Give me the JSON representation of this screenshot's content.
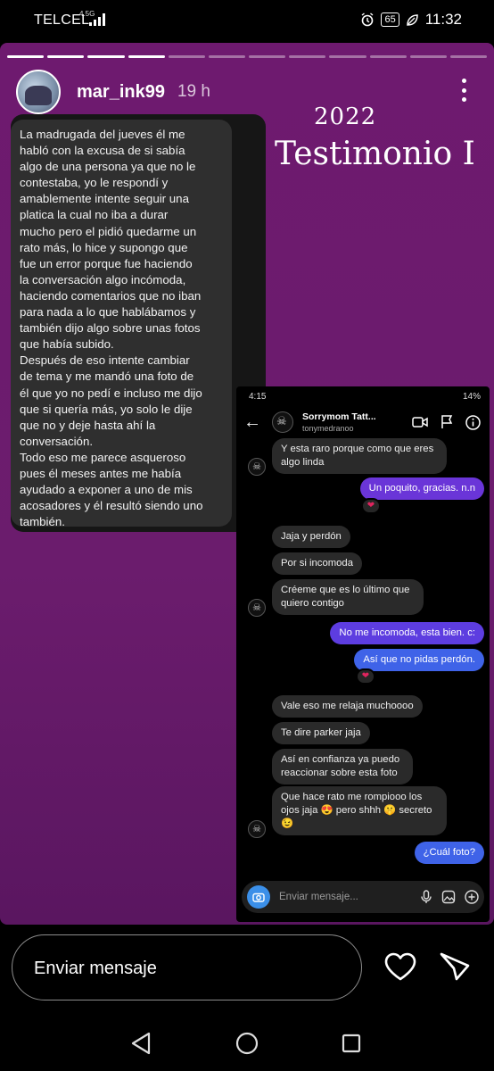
{
  "status_bar": {
    "carrier": "TELCEL",
    "network": "4.5G",
    "battery": "65",
    "time": "11:32"
  },
  "story": {
    "username": "mar_ink99",
    "time_ago": "19 h",
    "progress": {
      "total_segments": 12,
      "completed_segments": 4
    },
    "year": "2022",
    "title": "Testimonio I",
    "testimony_text": "La madrugada del jueves él me\nhabló con la excusa de si sabía\nalgo de una persona ya que no le\ncontestaba, yo le respondí y\namablemente intente seguir una\nplatica la cual no iba a durar\nmucho pero el pidió quedarme un\nrato más, lo hice y supongo que\nfue un error porque fue haciendo\nla conversación algo incómoda,\nhaciendo comentarios que no iban\npara nada a lo que hablábamos y\ntambién dijo algo sobre unas fotos\nque había subido.\nDespués de eso intente cambiar\nde tema y me mandó una foto de\nél que yo no pedí e incluso me dijo\nque si quería más, yo solo le dije\nque no y deje hasta ahí la\nconversación.\nTodo eso me parece asqueroso\npues él meses antes me había\nayudado a exponer a uno de mis\nacosadores y él resultó siendo uno\ntambién."
  },
  "chat": {
    "status_time": "4:15",
    "status_battery": "14%",
    "contact_name": "Sorrymom Tatt...",
    "contact_handle": "tonymedranoo",
    "messages": {
      "m1": "Y esta raro porque como que eres\nalgo linda",
      "m2": "Un poquito, gracias. n.n",
      "m3": "Jaja y perdón",
      "m4": "Por si incomoda",
      "m5": "Créeme que es lo último que\nquiero contigo",
      "m6": "No me incomoda, esta bien. c:",
      "m7": "Así que no pidas perdón.",
      "m8": "Vale eso me relaja muchoooo",
      "m9": "Te dire parker jaja",
      "m10": "Así en confianza ya puedo\nreaccionar sobre esta foto",
      "m11": "Que hace rato me rompiooo los\nojos jaja 😍 pero shhh 🤫 secreto\n😉",
      "m12": "¿Cuál foto?"
    },
    "composer_placeholder": "Enviar mensaje..."
  },
  "reply": {
    "placeholder": "Enviar mensaje"
  },
  "icons": {
    "heart": "heart-icon",
    "send": "send-icon",
    "more": "more-vertical-icon"
  }
}
